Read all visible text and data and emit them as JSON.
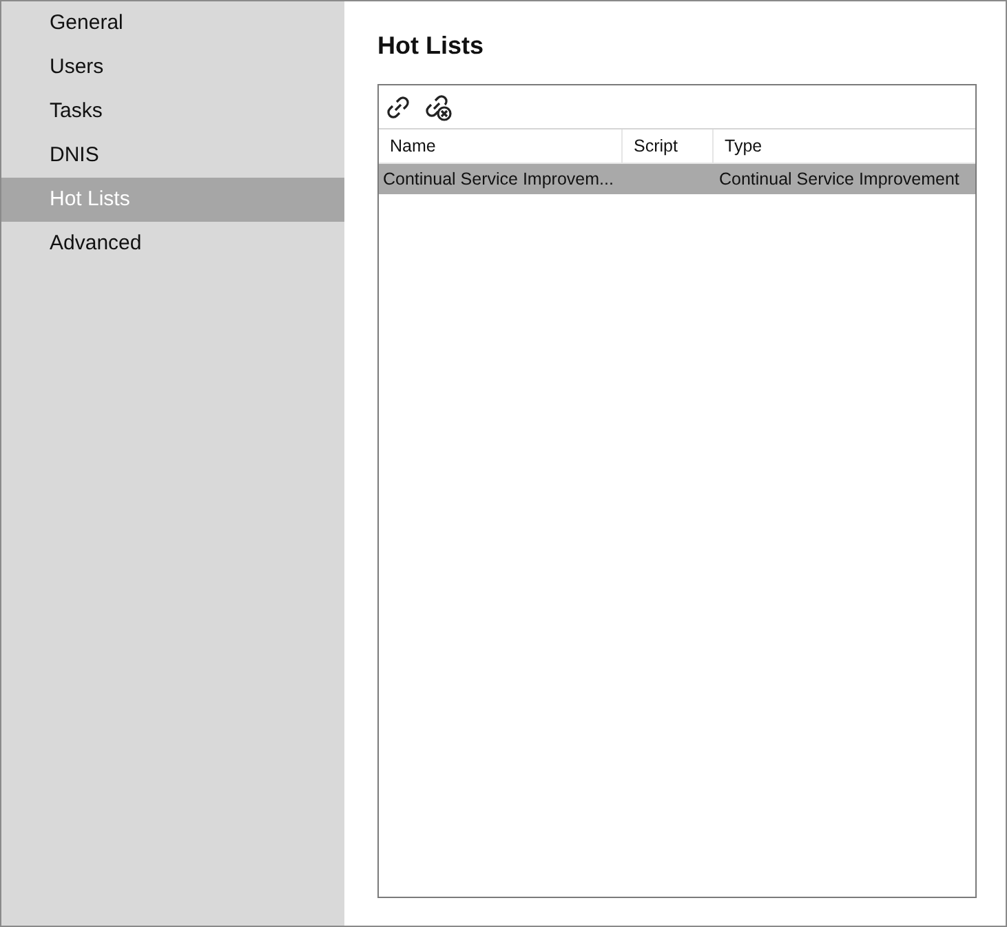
{
  "sidebar": {
    "items": [
      {
        "label": "General",
        "selected": false
      },
      {
        "label": "Users",
        "selected": false
      },
      {
        "label": "Tasks",
        "selected": false
      },
      {
        "label": "DNIS",
        "selected": false
      },
      {
        "label": "Hot Lists",
        "selected": true
      },
      {
        "label": "Advanced",
        "selected": false
      }
    ]
  },
  "content": {
    "title": "Hot Lists",
    "table": {
      "columns": [
        "Name",
        "Script",
        "Type"
      ],
      "rows": [
        {
          "cells": [
            "Continual Service Improvem...",
            "",
            "Continual Service Improvement"
          ],
          "selected": true
        }
      ]
    }
  }
}
